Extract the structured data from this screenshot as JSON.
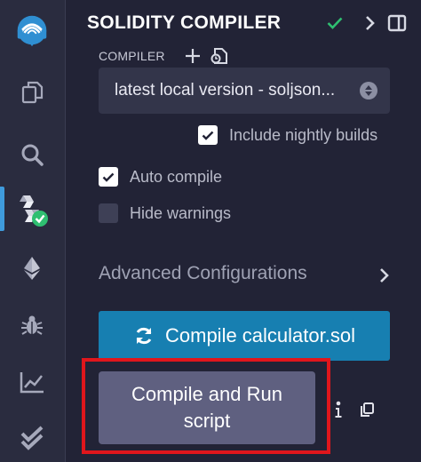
{
  "sidebar": {
    "icons": [
      {
        "name": "remix-logo-icon"
      },
      {
        "name": "file-explorer-icon"
      },
      {
        "name": "search-icon"
      },
      {
        "name": "solidity-compiler-icon",
        "active": true
      },
      {
        "name": "deploy-run-icon"
      },
      {
        "name": "debugger-icon"
      },
      {
        "name": "analytics-icon"
      },
      {
        "name": "verify-icon"
      }
    ],
    "accent_color": "#3f9bdc"
  },
  "header": {
    "title": "SOLIDITY COMPILER",
    "status_color": "#2fbf71"
  },
  "compiler": {
    "section_label": "COMPILER",
    "selected_version": "latest local version - soljson...",
    "include_nightly_label": "Include nightly builds",
    "include_nightly_checked": true,
    "auto_compile_label": "Auto compile",
    "auto_compile_checked": true,
    "hide_warnings_label": "Hide warnings",
    "hide_warnings_checked": false
  },
  "advanced": {
    "label": "Advanced Configurations"
  },
  "actions": {
    "compile_label": "Compile calculator.sol",
    "compile_color": "#177fb1",
    "run_script_label": "Compile and Run script",
    "highlight_color": "#e0161c"
  }
}
